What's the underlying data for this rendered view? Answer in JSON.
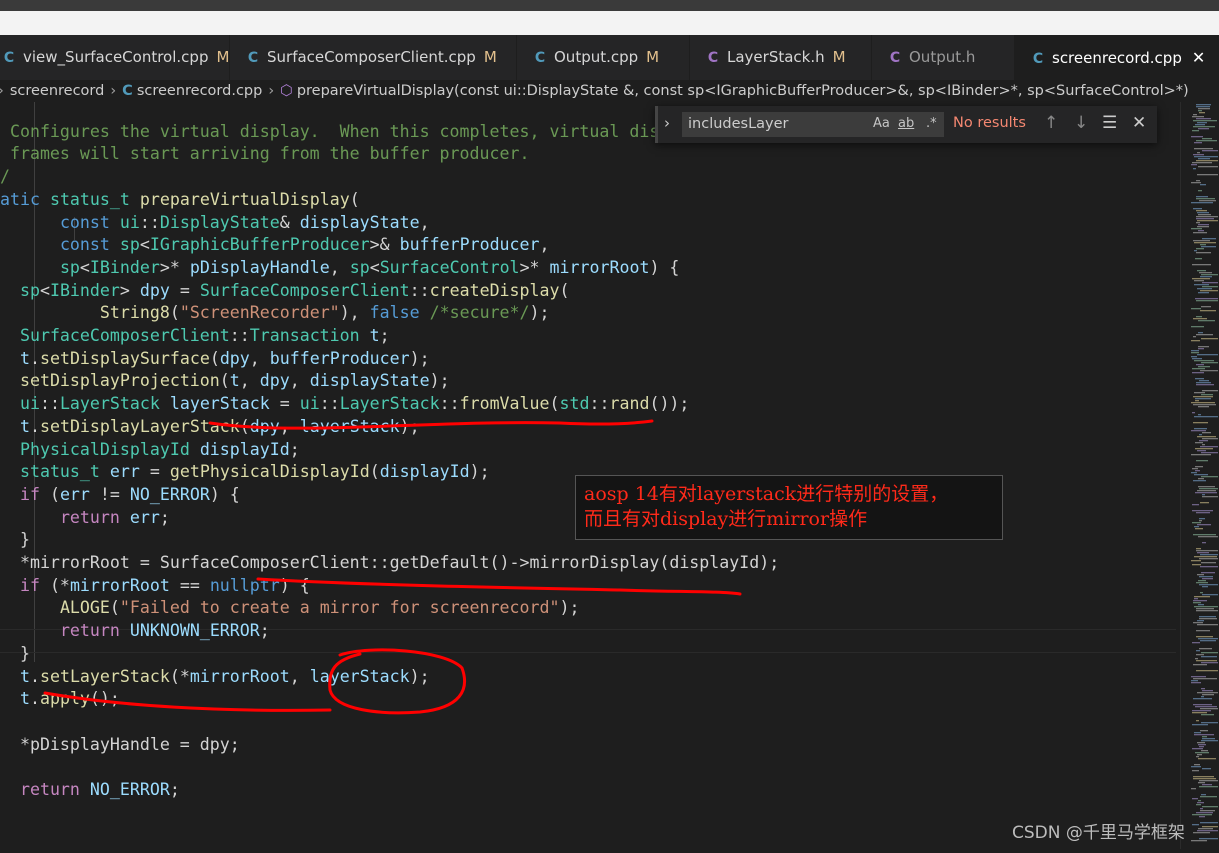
{
  "tabs": [
    {
      "label": "view_SurfaceControl.cpp",
      "kind": "cpp",
      "modified": "M"
    },
    {
      "label": "SurfaceComposerClient.cpp",
      "kind": "cpp",
      "modified": "M"
    },
    {
      "label": "Output.cpp",
      "kind": "cpp",
      "modified": "M"
    },
    {
      "label": "LayerStack.h",
      "kind": "h",
      "modified": "M"
    },
    {
      "label": "Output.h",
      "kind": "h",
      "modified": ""
    },
    {
      "label": "screenrecord.cpp",
      "kind": "cpp",
      "modified": "",
      "active": true,
      "close": "✕"
    }
  ],
  "breadcrumb": {
    "folder": "screenrecord",
    "file": "screenrecord.cpp",
    "symbol": "prepareVirtualDisplay(const ui::DisplayState &, const sp<IGraphicBufferProducer>&, sp<IBinder>*, sp<SurfaceControl>*)"
  },
  "find": {
    "query": "includesLayer",
    "match_case": "Aa",
    "whole_word": "ab",
    "regex": ".*",
    "result": "No results"
  },
  "code_lines": [
    "/*",
    " * Configures the virtual display.  When this completes, virtual display",
    " * frames will start arriving from the buffer producer.",
    " */",
    "static status_t prepareVirtualDisplay(",
    "        const ui::DisplayState& displayState,",
    "        const sp<IGraphicBufferProducer>& bufferProducer,",
    "        sp<IBinder>* pDisplayHandle, sp<SurfaceControl>* mirrorRoot) {",
    "    sp<IBinder> dpy = SurfaceComposerClient::createDisplay(",
    "            String8(\"ScreenRecorder\"), false /*secure*/);",
    "    SurfaceComposerClient::Transaction t;",
    "    t.setDisplaySurface(dpy, bufferProducer);",
    "    setDisplayProjection(t, dpy, displayState);",
    "    ui::LayerStack layerStack = ui::LayerStack::fromValue(std::rand());",
    "    t.setDisplayLayerStack(dpy, layerStack);",
    "    PhysicalDisplayId displayId;",
    "    status_t err = getPhysicalDisplayId(displayId);",
    "    if (err != NO_ERROR) {",
    "        return err;",
    "    }",
    "    *mirrorRoot = SurfaceComposerClient::getDefault()->mirrorDisplay(displayId);",
    "    if (*mirrorRoot == nullptr) {",
    "        ALOGE(\"Failed to create a mirror for screenrecord\");",
    "        return UNKNOWN_ERROR;",
    "    }",
    "    t.setLayerStack(*mirrorRoot, layerStack);",
    "    t.apply();",
    "",
    "    *pDisplayHandle = dpy;",
    "",
    "    return NO_ERROR;"
  ],
  "annotation": {
    "line1": "aosp 14有对layerstack进行特别的设置，",
    "line2": "而且有对display进行mirror操作",
    "color": "#ff2a1a"
  },
  "watermark": "CSDN @千里马学框架",
  "colors": {
    "keyword": "#569cd6",
    "type": "#4ec9b0",
    "function": "#dcdcaa",
    "variable": "#9cdcfe",
    "string": "#ce9178",
    "comment": "#6a9955",
    "ink": "#ff0000"
  },
  "icons": {
    "cpp_file": "cpp-file-icon",
    "h_file": "c-header-file-icon",
    "symbol": "method-cube-icon",
    "close": "close-icon"
  }
}
